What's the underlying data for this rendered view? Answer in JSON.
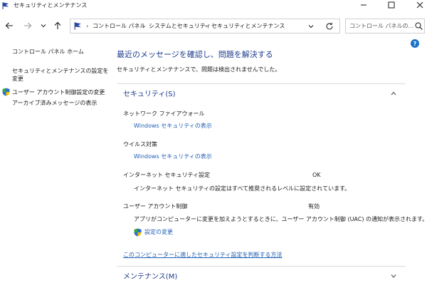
{
  "window": {
    "title": "セキュリティとメンテナンス"
  },
  "address": {
    "crumbs": [
      "コントロール パネル",
      "システムとセキュリティ",
      "セキュリティとメンテナンス"
    ],
    "search_placeholder": "コントロール パネルの..."
  },
  "sidebar": {
    "items": [
      "コントロール パネル ホーム",
      "セキュリティとメンテナンスの設定を",
      "変更",
      "ユーザー アカウント制御設定の変更",
      "アーカイブ済みメッセージの表示"
    ]
  },
  "help_label": "?",
  "main": {
    "title": "最近のメッセージを確認し、問題を解決する",
    "subtitle": "セキュリティとメンテナンスで、問題は検出されませんでした。"
  },
  "security": {
    "header": "セキュリティ(S)",
    "firewall": {
      "label": "ネットワーク ファイアウォール",
      "link": "Windows セキュリティの表示"
    },
    "virus": {
      "label": "ウイルス対策",
      "link": "Windows セキュリティの表示"
    },
    "internet": {
      "label": "インターネット セキュリティ設定",
      "status": "OK",
      "desc": "インターネット セキュリティの設定はすべて推奨されるレベルに設定されています。"
    },
    "uac": {
      "label": "ユーザー アカウント制御",
      "status": "有効",
      "desc": "アプリがコンピューターに変更を加えようとするときに、ユーザー アカウント制御 (UAC) の通知が表示されます。",
      "link": "設定の変更"
    },
    "more_link": "このコンピューターに適したセキュリティ設定を判断する方法"
  },
  "maintenance": {
    "header": "メンテナンス(M)"
  },
  "colors": {
    "heading": "#1e3c8c",
    "link": "#1f5fb3",
    "help": "#1a73c9"
  }
}
